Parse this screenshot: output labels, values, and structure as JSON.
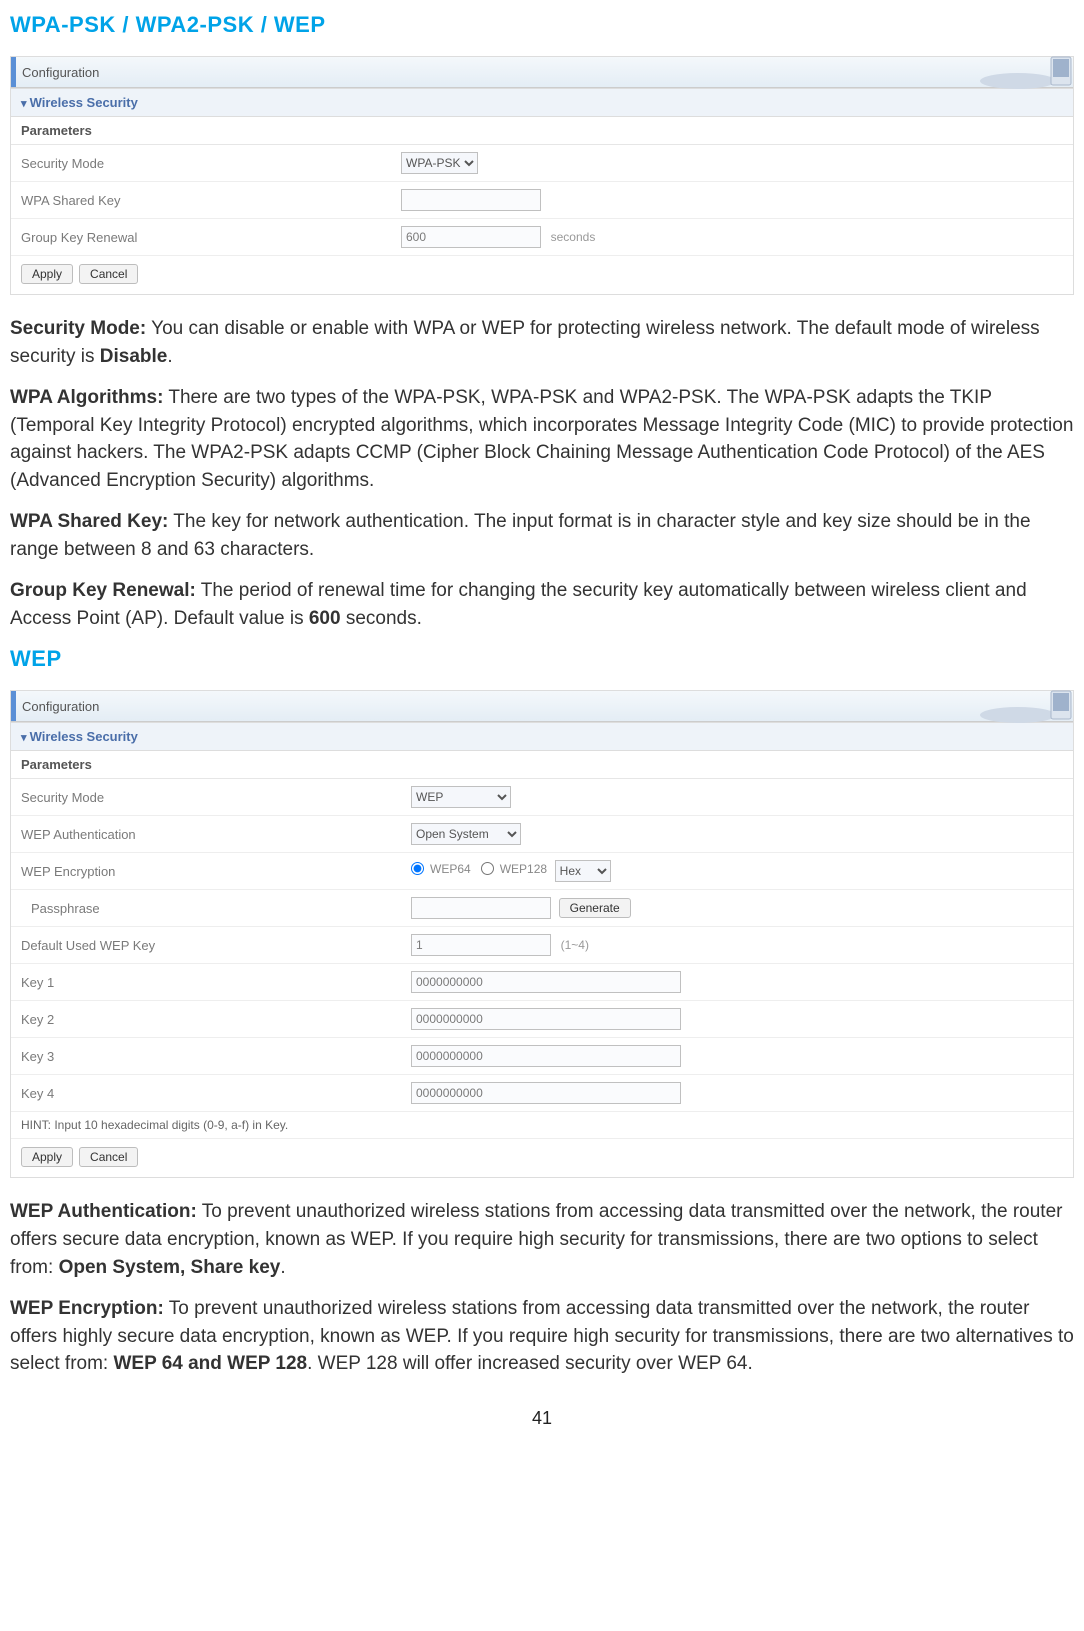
{
  "heading1": "WPA-PSK / WPA2-PSK / WEP",
  "panel1": {
    "tab": "Configuration",
    "section": "Wireless Security",
    "subheader": "Parameters",
    "rows": {
      "secmode_label": "Security Mode",
      "secmode_value": "WPA-PSK",
      "sharedkey_label": "WPA Shared Key",
      "sharedkey_value": "",
      "renewal_label": "Group Key Renewal",
      "renewal_value": "600",
      "renewal_suffix": "seconds"
    },
    "apply": "Apply",
    "cancel": "Cancel"
  },
  "para1": {
    "b": "Security Mode:",
    "t1": " You can disable or enable with WPA or WEP for protecting wireless network. The default mode of wireless security is ",
    "b2": "Disable",
    "t2": "."
  },
  "para2": {
    "b": "WPA Algorithms:",
    "t": " There are two types of the WPA-PSK, WPA-PSK and WPA2-PSK.  The WPA-PSK adapts the TKIP (Temporal Key Integrity Protocol) encrypted algorithms, which incorporates Message Integrity Code (MIC) to provide protection against hackers. The WPA2-PSK adapts CCMP (Cipher Block Chaining Message Authentication Code Protocol) of the AES (Advanced Encryption Security) algorithms."
  },
  "para3": {
    "b": "WPA Shared Key:",
    "t": " The key for network authentication. The input format is in character style and key size should be in the range between 8 and 63 characters."
  },
  "para4": {
    "b": "Group Key Renewal:",
    "t1": " The period of renewal time for changing the security key automatically between wireless client and Access Point (AP). Default value is ",
    "b2": "600",
    "t2": " seconds."
  },
  "heading2": "WEP",
  "panel2": {
    "tab": "Configuration",
    "section": "Wireless Security",
    "subheader": "Parameters",
    "rows": {
      "secmode_label": "Security Mode",
      "secmode_value": "WEP",
      "auth_label": "WEP Authentication",
      "auth_value": "Open System",
      "enc_label": "WEP Encryption",
      "enc_opt1": "WEP64",
      "enc_opt2": "WEP128",
      "enc_select": "Hex",
      "pass_label": "Passphrase",
      "pass_value": "",
      "generate": "Generate",
      "defkey_label": "Default Used WEP Key",
      "defkey_value": "1",
      "defkey_suffix": "(1~4)",
      "k1l": "Key 1",
      "k1v": "0000000000",
      "k2l": "Key 2",
      "k2v": "0000000000",
      "k3l": "Key 3",
      "k3v": "0000000000",
      "k4l": "Key 4",
      "k4v": "0000000000"
    },
    "hint": "HINT: Input 10 hexadecimal digits (0-9, a-f) in Key.",
    "apply": "Apply",
    "cancel": "Cancel"
  },
  "para5": {
    "b": "WEP Authentication:",
    "t1": " To prevent unauthorized wireless stations from accessing data transmitted over the network, the router offers secure data encryption, known as WEP. If you require high security for transmissions, there are two options to select from: ",
    "b2": "Open System, Share key",
    "t2": "."
  },
  "para6": {
    "b": "WEP Encryption:",
    "t1": " To prevent unauthorized wireless stations from accessing data transmitted over the network, the router offers highly secure data encryption, known as WEP. If you require high security for transmissions, there are two alternatives to select from: ",
    "b2": "WEP 64 and WEP 128",
    "t2": ". WEP 128 will offer increased security over WEP 64."
  },
  "pagenum": "41"
}
